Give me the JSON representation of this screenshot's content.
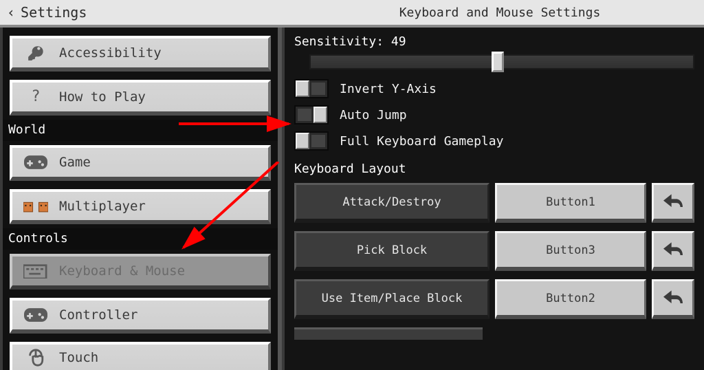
{
  "header": {
    "back_label": "Settings",
    "title": "Keyboard and Mouse Settings"
  },
  "sidebar": {
    "items": [
      {
        "label": "Accessibility"
      },
      {
        "label": "How to Play"
      }
    ],
    "section_world": "World",
    "world_items": [
      {
        "label": "Game"
      },
      {
        "label": "Multiplayer"
      }
    ],
    "section_controls": "Controls",
    "control_items": [
      {
        "label": "Keyboard & Mouse"
      },
      {
        "label": "Controller"
      },
      {
        "label": "Touch"
      }
    ]
  },
  "panel": {
    "sensitivity_label": "Sensitivity: 49",
    "sensitivity_value": 49,
    "toggles": [
      {
        "label": "Invert Y-Axis",
        "on": false
      },
      {
        "label": "Auto Jump",
        "on": true
      },
      {
        "label": "Full Keyboard Gameplay",
        "on": false
      }
    ],
    "layout_header": "Keyboard Layout",
    "bindings": [
      {
        "action": "Attack/Destroy",
        "key": "Button1"
      },
      {
        "action": "Pick Block",
        "key": "Button3"
      },
      {
        "action": "Use Item/Place Block",
        "key": "Button2"
      }
    ]
  }
}
